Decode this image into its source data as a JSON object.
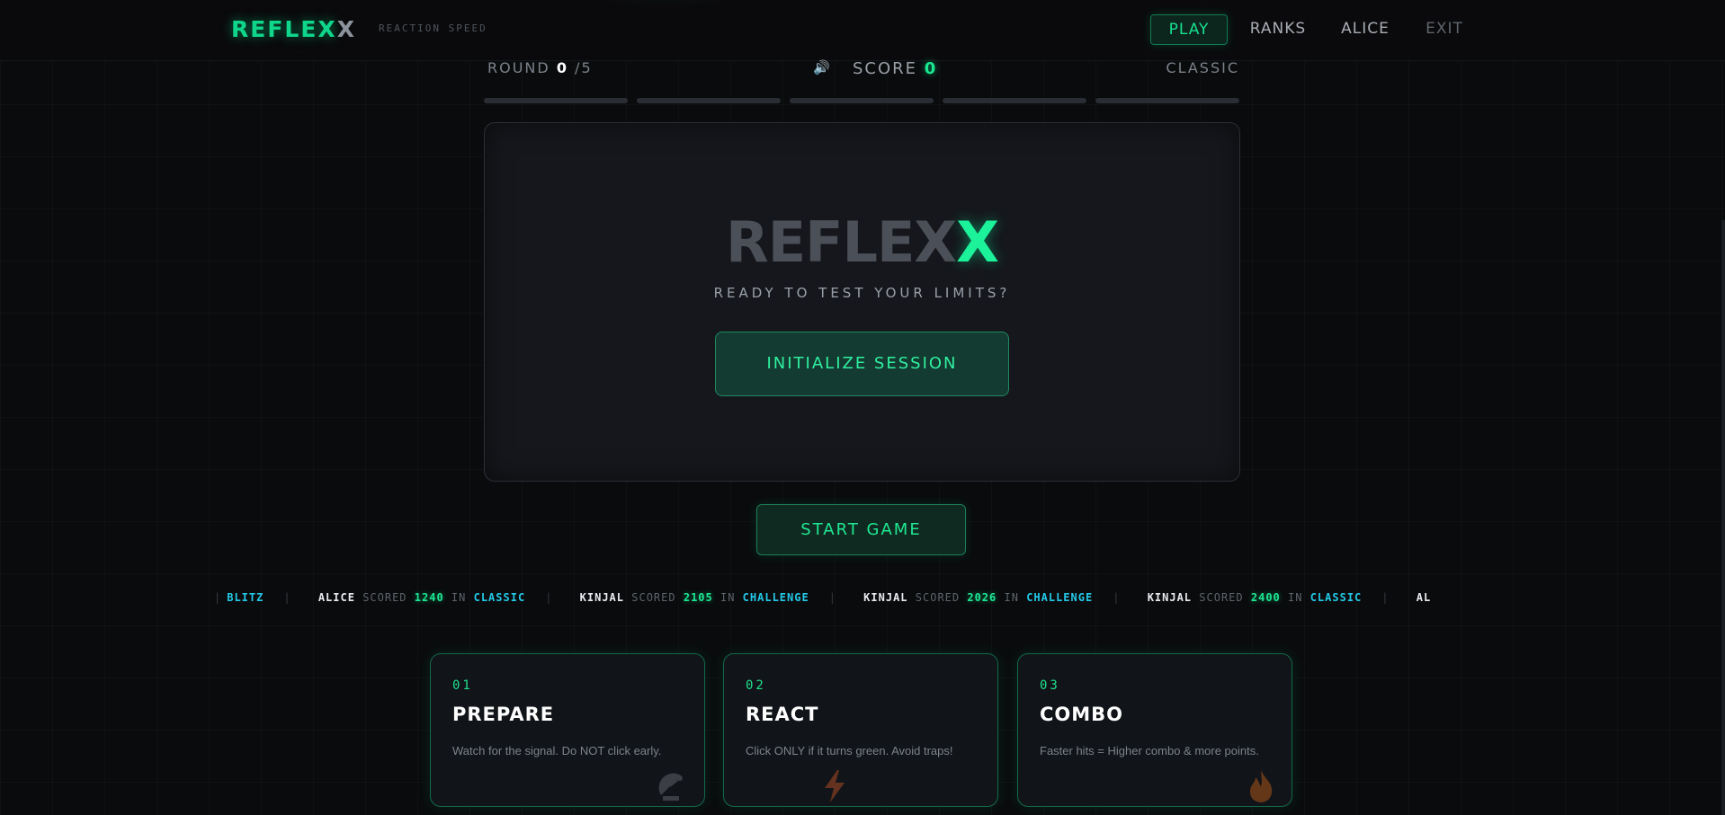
{
  "header": {
    "logo_main": "REFLEX",
    "logo_x": "X",
    "tagline": "REACTION SPEED",
    "nav": [
      {
        "label": "PLAY",
        "active": true
      },
      {
        "label": "RANKS",
        "active": false
      },
      {
        "label": "ALICE",
        "active": false
      },
      {
        "label": "EXIT",
        "active": false
      }
    ]
  },
  "status": {
    "round_label": "ROUND",
    "round_current": "0",
    "round_total": "/5",
    "sound_icon": "speaker-icon",
    "score_label": "SCORE",
    "score_value": "0",
    "mode": "CLASSIC"
  },
  "progress": {
    "segments_total": 5,
    "segments_filled": 0
  },
  "panel": {
    "logo_main": "REFLEX",
    "logo_x": "X",
    "subtitle": "READY TO TEST YOUR LIMITS?",
    "init_button": "INITIALIZE SESSION"
  },
  "start_button": "START GAME",
  "ticker": {
    "lead_fragment": "BLITZ",
    "items": [
      {
        "name": "ALICE",
        "scored": "SCORED",
        "score": "1240",
        "in": "IN",
        "mode": "CLASSIC"
      },
      {
        "name": "KINJAL",
        "scored": "SCORED",
        "score": "2105",
        "in": "IN",
        "mode": "CHALLENGE"
      },
      {
        "name": "KINJAL",
        "scored": "SCORED",
        "score": "2026",
        "in": "IN",
        "mode": "CHALLENGE"
      },
      {
        "name": "KINJAL",
        "scored": "SCORED",
        "score": "2400",
        "in": "IN",
        "mode": "CLASSIC"
      }
    ],
    "tail_fragment": "AL"
  },
  "cards": [
    {
      "num": "01",
      "title": "PREPARE",
      "desc": "Watch for the signal. Do NOT click early.",
      "icon": "satellite-dish-icon"
    },
    {
      "num": "02",
      "title": "REACT",
      "desc": "Click ONLY if it turns green. Avoid traps!",
      "icon": "lightning-icon"
    },
    {
      "num": "03",
      "title": "COMBO",
      "desc": "Faster hits = Higher combo & more points.",
      "icon": "flame-icon"
    }
  ],
  "colors": {
    "accent": "#1cf29a",
    "ticker_mode": "#24c9e8",
    "background": "#0a0b0d",
    "panel": "#15171c"
  }
}
